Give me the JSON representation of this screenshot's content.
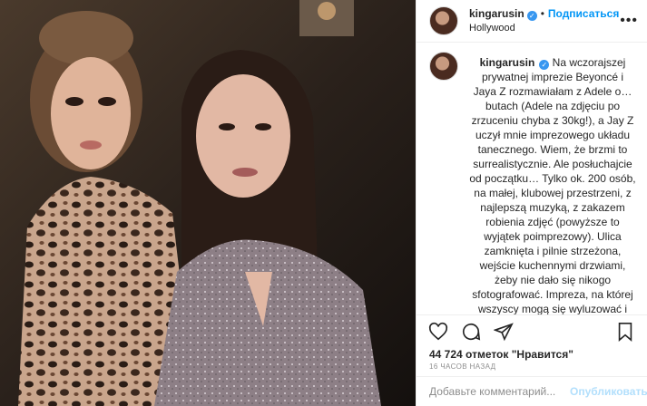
{
  "header": {
    "username": "kingarusin",
    "follow_label": "Подписаться",
    "separator": "•",
    "location": "Hollywood",
    "more_label": "•••"
  },
  "caption": {
    "username": "kingarusin",
    "text": "Na wczorajszej prywatnej imprezie Beyoncé i Jaya Z rozmawiałam z Adele o… butach (Adele na zdjęciu po zrzuceniu chyba z 30kg!), a Jay Z uczył mnie imprezowego układu tanecznego. Wiem, że brzmi to surrealistycznie. Ale posłuchajcie od początku… Tylko ok. 200 osób, na małej,  klubowej przestrzeni, z najlepszą muzyką, z zakazem robienia zdjęć (powyższe to wyjątek poimprezowy). Ulica zamknięta i pilnie strzeżona, wejście kuchennymi drzwiami, żeby nie dało się nikogo sfotografować. Impreza, na której wszyscy mogą się wyluzować i zaszaleć! Każdy dostaje na wejściu … kapcie (nie weszłam w tę opcję) i bawi się bez skrępowania do białego rana. Zaczęło się od rozmowy z Adele o"
  },
  "actions": {
    "like_icon": "heart-icon",
    "comment_icon": "comment-icon",
    "share_icon": "share-icon",
    "save_icon": "bookmark-icon"
  },
  "likes": "44 724 отметок \"Нравится\"",
  "time": "16 ЧАСОВ НАЗАД",
  "comment": {
    "placeholder": "Добавьте комментарий...",
    "publish_label": "Опубликовать"
  },
  "colors": {
    "accent": "#0095f6",
    "verified": "#3897f0",
    "publish_disabled": "#b2dffc"
  }
}
